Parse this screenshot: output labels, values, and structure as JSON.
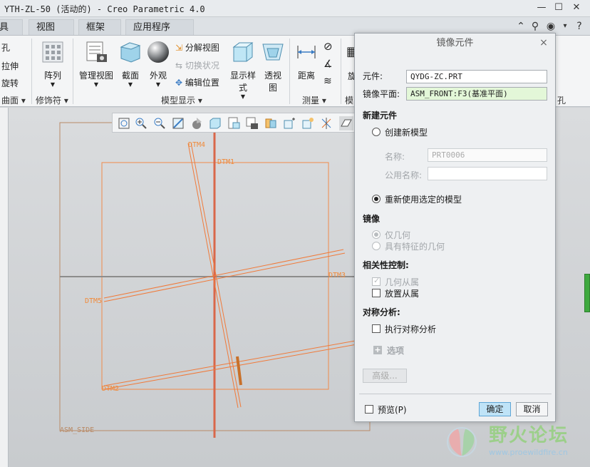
{
  "window": {
    "title": "YTH-ZL-50 (活动的) - Creo Parametric 4.0",
    "controls": [
      "minimize-icon",
      "maximize-icon",
      "close-icon"
    ]
  },
  "tabs": [
    "具",
    "视图",
    "框架",
    "应用程序"
  ],
  "ribbon": {
    "left_items": [
      "孔",
      "拉伸",
      "旋转"
    ],
    "group_surface": "曲面",
    "pattern_label": "阵列",
    "group_modifier": "修饰符",
    "manage_view": "管理视图",
    "section": "截面",
    "appearance": "外观",
    "explode_view": "分解视图",
    "toggle_state": "切换状况",
    "edit_position": "编辑位置",
    "display_style": "显示样式",
    "perspective": "透视图",
    "group_model_display": "模型显示",
    "distance": "距离",
    "group_measure": "测量",
    "cut_label_1": "旋",
    "cut_label_2": "模",
    "cut_label_3": "孔"
  },
  "viewport": {
    "labels": [
      "DTM4",
      "DTM1",
      "DTM5",
      "DTM3",
      "DTM2",
      "ASM_SIDE"
    ],
    "accent_color": "#f07a3a"
  },
  "dialog": {
    "title": "镜像元件",
    "component_label": "元件:",
    "component_value": "QYDG-ZC.PRT",
    "mirror_plane_label": "镜像平面:",
    "mirror_plane_value": "ASM_FRONT:F3(基准平面)",
    "new_component_head": "新建元件",
    "create_new_model": "创建新模型",
    "name_label": "名称:",
    "name_value": "PRT0006",
    "common_name_label": "公用名称:",
    "common_name_value": "",
    "reuse_model": "重新使用选定的模型",
    "mirror_head": "镜像",
    "geometry_only": "仅几何",
    "geometry_with_features": "具有特征的几何",
    "dependency_head": "相关性控制:",
    "geometry_dependent": "几何从属",
    "placement_dependent": "放置从属",
    "symmetry_head": "对称分析:",
    "run_symmetry": "执行对称分析",
    "options": "选项",
    "advanced": "高级...",
    "preview": "预览(P)",
    "ok": "确定",
    "cancel": "取消"
  },
  "watermark": {
    "title": "野火论坛",
    "url": "www.proewildfire.cn"
  }
}
